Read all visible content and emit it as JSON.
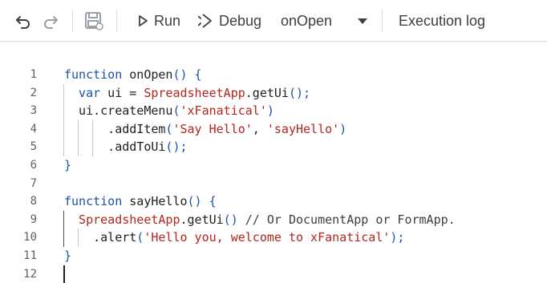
{
  "toolbar": {
    "undo_icon": "undo-icon",
    "redo_icon": "redo-icon",
    "save_icon": "save-icon",
    "run_label": "Run",
    "debug_label": "Debug",
    "function_select_value": "onOpen",
    "execution_log_label": "Execution log"
  },
  "editor": {
    "line_numbers": [
      "1",
      "2",
      "3",
      "4",
      "5",
      "6",
      "7",
      "8",
      "9",
      "10",
      "11",
      "12"
    ],
    "lines": [
      [
        {
          "t": "function",
          "c": "kw"
        },
        {
          "t": " onOpen",
          "c": "pn"
        },
        {
          "t": "() {",
          "c": "kw"
        }
      ],
      [
        {
          "t": "var",
          "c": "kw"
        },
        {
          "t": " ui = ",
          "c": "pn"
        },
        {
          "t": "SpreadsheetApp",
          "c": "cls"
        },
        {
          "t": ".getUi",
          "c": "pn"
        },
        {
          "t": "();",
          "c": "kw"
        }
      ],
      [
        {
          "t": "ui.createMenu",
          "c": "pn"
        },
        {
          "t": "(",
          "c": "kw"
        },
        {
          "t": "'xFanatical'",
          "c": "str"
        },
        {
          "t": ")",
          "c": "kw"
        }
      ],
      [
        {
          "t": ".addItem",
          "c": "pn"
        },
        {
          "t": "(",
          "c": "kw"
        },
        {
          "t": "'Say Hello'",
          "c": "str"
        },
        {
          "t": ", ",
          "c": "pn"
        },
        {
          "t": "'sayHello'",
          "c": "str"
        },
        {
          "t": ")",
          "c": "kw"
        }
      ],
      [
        {
          "t": ".addToUi",
          "c": "pn"
        },
        {
          "t": "();",
          "c": "kw"
        }
      ],
      [
        {
          "t": "}",
          "c": "kw"
        }
      ],
      [],
      [
        {
          "t": "function",
          "c": "kw"
        },
        {
          "t": " sayHello",
          "c": "pn"
        },
        {
          "t": "() {",
          "c": "kw"
        }
      ],
      [
        {
          "t": "SpreadsheetApp",
          "c": "cls"
        },
        {
          "t": ".getUi",
          "c": "pn"
        },
        {
          "t": "()",
          "c": "kw"
        },
        {
          "t": " // Or DocumentApp or FormApp.",
          "c": "cm"
        }
      ],
      [
        {
          "t": ".alert",
          "c": "pn"
        },
        {
          "t": "(",
          "c": "kw"
        },
        {
          "t": "'Hello you, welcome to xFanatical'",
          "c": "str"
        },
        {
          "t": ");",
          "c": "kw"
        }
      ],
      [
        {
          "t": "}",
          "c": "kw"
        }
      ],
      []
    ]
  },
  "colors": {
    "keyword": "#1a53a8",
    "string": "#b3261e",
    "text": "#202124"
  }
}
